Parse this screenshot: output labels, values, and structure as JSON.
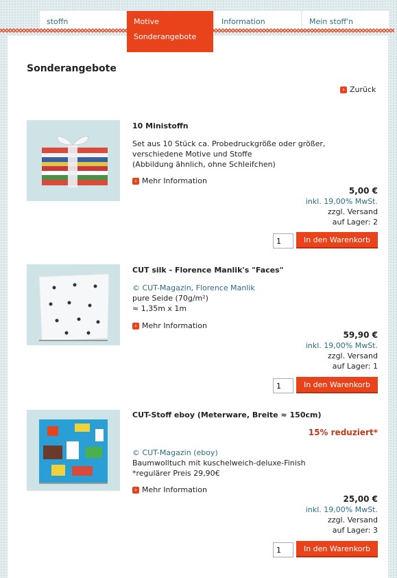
{
  "nav": {
    "tabs": [
      {
        "label": "stoffn"
      },
      {
        "label": "Motive",
        "sub": "Sonderangebote"
      },
      {
        "label": "Information"
      },
      {
        "label": "Mein stoff'n"
      }
    ]
  },
  "page": {
    "title": "Sonderangebote",
    "back_label": "Zurück"
  },
  "products": [
    {
      "name": "10 Ministoffn",
      "desc_lines": [
        "Set aus 10 Stück ca. Probedruckgröße oder größer,",
        "verschiedene Motive und Stoffe",
        "(Abbildung ähnlich, ohne Schleifchen)"
      ],
      "more": "Mehr Information",
      "price": "5,00 €",
      "tax": "inkl. 19,00% MwSt.",
      "shipping": "zzgl. Versand",
      "stock": "auf Lager: 2",
      "qty": "1",
      "cart": "In den Warenkorb"
    },
    {
      "name": "CUT silk - Florence Manlik's \"Faces\"",
      "credit": "© CUT-Magazin, Florence Manlik",
      "desc_lines": [
        "pure Seide (70g/m²)",
        "≈ 1,35m x 1m"
      ],
      "more": "Mehr Information",
      "price": "59,90 €",
      "tax": "inkl. 19,00% MwSt.",
      "shipping": "zzgl. Versand",
      "stock": "auf Lager: 1",
      "qty": "1",
      "cart": "In den Warenkorb"
    },
    {
      "name": "CUT-Stoff eboy (Meterware, Breite ≈ 150cm)",
      "discount": "15% reduziert*",
      "credit": "© CUT-Magazin (eboy)",
      "desc_lines": [
        "Baumwolltuch mit kuschelweich-deluxe-Finish",
        "*regulärer Preis 29,90€"
      ],
      "more": "Mehr Information",
      "price": "25,00 €",
      "tax": "inkl. 19,00% MwSt.",
      "shipping": "zzgl. Versand",
      "stock": "auf Lager: 3",
      "qty": "1",
      "cart": "In den Warenkorb"
    }
  ],
  "colors": {
    "accent": "#e8431a",
    "link": "#2a6b85",
    "discount": "#c0391b"
  }
}
